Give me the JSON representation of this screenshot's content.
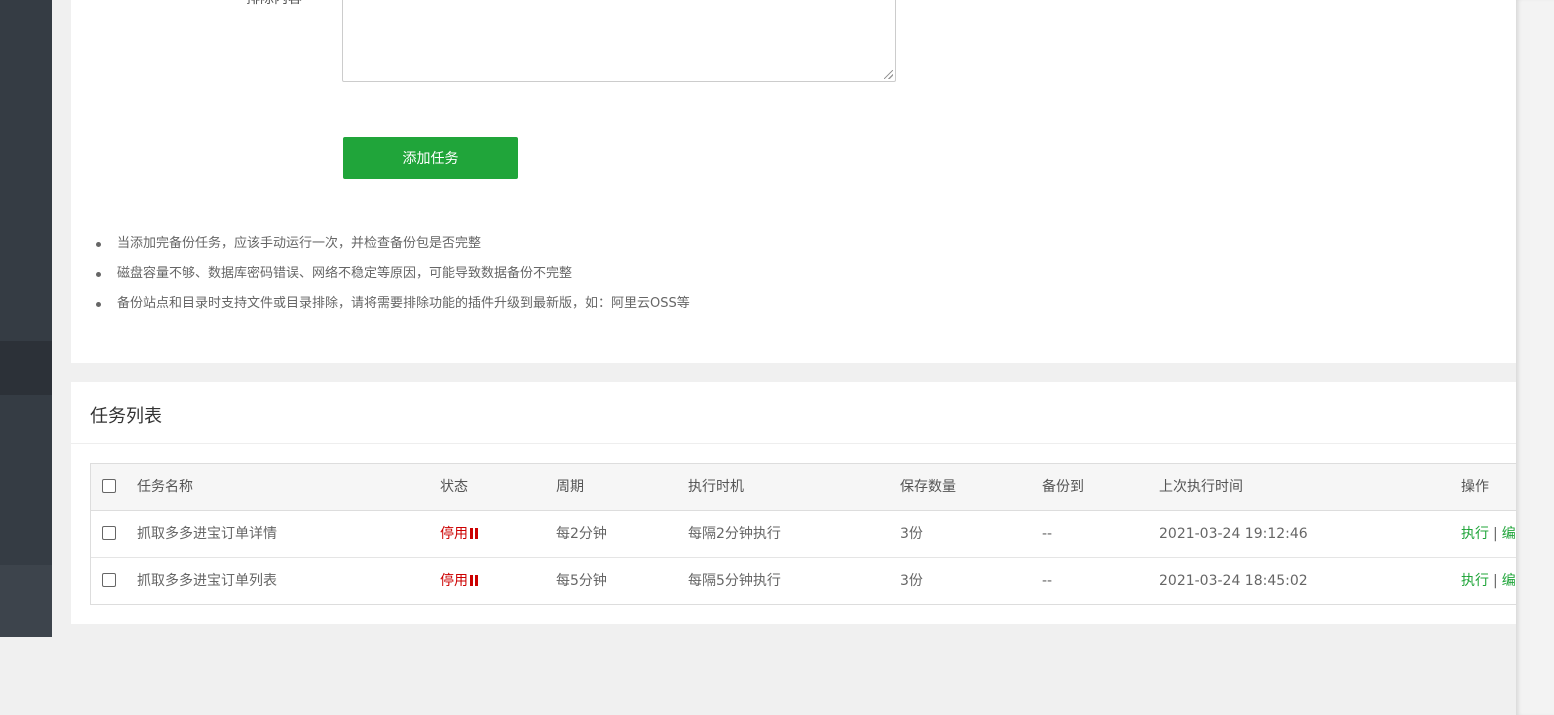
{
  "form": {
    "field_label": "排除内容",
    "submit_label": "添加任务"
  },
  "tips": [
    "当添加完备份任务，应该手动运行一次，并检查备份包是否完整",
    "磁盘容量不够、数据库密码错误、网络不稳定等原因，可能导致数据备份不完整",
    "备份站点和目录时支持文件或目录排除，请将需要排除功能的插件升级到最新版，如：阿里云OSS等"
  ],
  "task_list": {
    "title": "任务列表",
    "columns": [
      "任务名称",
      "状态",
      "周期",
      "执行时机",
      "保存数量",
      "备份到",
      "上次执行时间",
      "操作"
    ],
    "rows": [
      {
        "name": "抓取多多进宝订单详情",
        "status": "停用",
        "cycle": "每2分钟",
        "timing": "每隔2分钟执行",
        "keep": "3份",
        "backup_to": "--",
        "last_run": "2021-03-24 19:12:46",
        "action_run": "执行",
        "action_sep": "|",
        "action_edit": "编"
      },
      {
        "name": "抓取多多进宝订单列表",
        "status": "停用",
        "cycle": "每5分钟",
        "timing": "每隔5分钟执行",
        "keep": "3份",
        "backup_to": "--",
        "last_run": "2021-03-24 18:45:02",
        "action_run": "执行",
        "action_sep": "|",
        "action_edit": "编"
      }
    ]
  },
  "colors": {
    "accent": "#20a53a",
    "status_disabled": "#cc0000",
    "sidebar": "#353c44"
  },
  "icons": {
    "status": "pause-icon",
    "resize": "resize-grip-icon"
  }
}
